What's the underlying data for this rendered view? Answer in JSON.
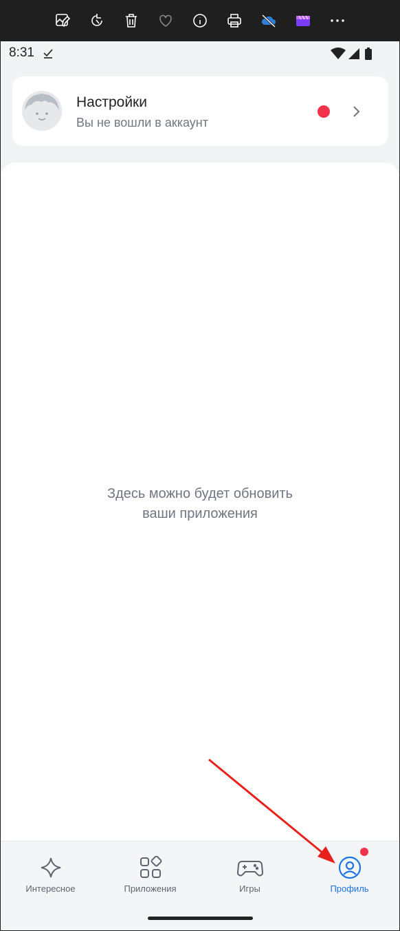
{
  "status_bar": {
    "time": "8:31"
  },
  "settings_card": {
    "title": "Настройки",
    "subtitle": "Вы не вошли в аккаунт",
    "notification_color": "#f3324b"
  },
  "main": {
    "empty_line1": "Здесь можно будет обновить",
    "empty_line2": "ваши приложения"
  },
  "bottom_nav": {
    "active_color": "#1a73e8",
    "items": [
      {
        "label": "Интересное",
        "icon": "sparkle-icon"
      },
      {
        "label": "Приложения",
        "icon": "apps-grid-icon"
      },
      {
        "label": "Игры",
        "icon": "gamepad-icon"
      },
      {
        "label": "Профиль",
        "icon": "profile-icon",
        "active": true
      }
    ]
  },
  "toolbar_icons": [
    "edit-image-icon",
    "rotate-icon",
    "delete-icon",
    "favorite-icon",
    "info-icon",
    "print-icon",
    "onedrive-off-icon",
    "clipchamp-icon",
    "more-icon"
  ]
}
